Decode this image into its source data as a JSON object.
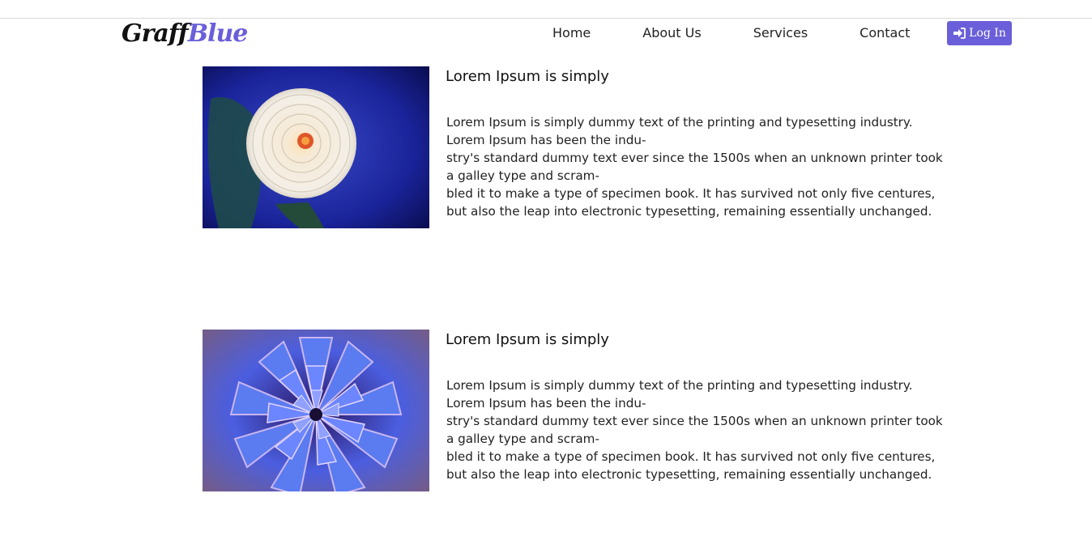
{
  "header": {
    "logo_part1": "Graff",
    "logo_part2": "Blue",
    "nav": [
      "Home",
      "About Us",
      "Services",
      "Contact"
    ],
    "login_label": "Log In",
    "login_icon": "sign-in-icon",
    "accent_color": "#6a5fd8"
  },
  "cards": [
    {
      "image": "white-dahlia-flower-photo",
      "title": "Lorem Ipsum is simply",
      "lines": [
        "Lorem Ipsum is simply dummy text of the printing and typesetting industry.",
        "Lorem Ipsum has been the indu-",
        "stry's standard dummy text ever since the 1500s when an unknown printer took",
        "a galley type and scram-",
        "bled it to make a type of specimen book. It has survived not only five centures,",
        "but also the leap into electronic typesetting, remaining essentially unchanged."
      ]
    },
    {
      "image": "blue-dahlia-flower-photo",
      "title": "Lorem Ipsum is simply",
      "lines": [
        "Lorem Ipsum is simply dummy text of the printing and typesetting industry.",
        "Lorem Ipsum has been the indu-",
        "stry's standard dummy text ever since the 1500s when an unknown printer took",
        "a galley type and scram-",
        "bled it to make a type of specimen book. It has survived not only five centures,",
        "but also the leap into electronic typesetting, remaining essentially unchanged."
      ]
    }
  ]
}
